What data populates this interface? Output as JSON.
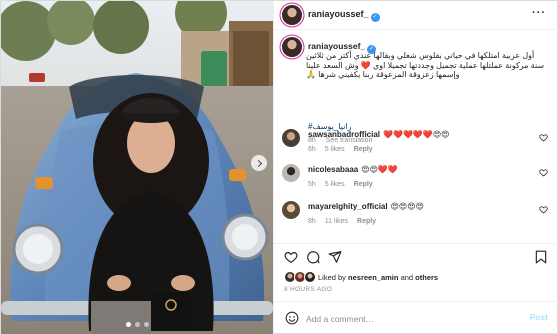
{
  "post": {
    "username": "raniayoussef_",
    "verified_icon": "verified-badge-icon",
    "more_icon": "more-options-icon"
  },
  "caption": {
    "username": "raniayoussef_",
    "text": "أول عربية امتلكها في حياتي بفلوس شغلي وبقالها عندي أكتر من ثلاثين سنة مركونة عملتلها عملية تجميل وجددتها تجميلا اوي ❤️ وش السعد علينا وإسمها زعزوقة المزعوقة ربنا يكفيني شرها 🙏",
    "hashtag": "#رانيا_يوسف",
    "time": "8h",
    "see_translation": "See translation"
  },
  "comments": [
    {
      "username": "sawsanbadrofficial",
      "text": "❤️❤️❤️❤️❤️😍😍",
      "time": "6h",
      "likes": "5 likes",
      "reply": "Reply"
    },
    {
      "username": "nicolesabaaa",
      "text": "😍😍❤️❤️",
      "time": "5h",
      "likes": "5 likes",
      "reply": "Reply"
    },
    {
      "username": "mayarelghity_official",
      "text": "😍😍😍😍",
      "time": "8h",
      "likes": "11 likes",
      "reply": "Reply"
    }
  ],
  "actions": {
    "like_icon": "heart-icon",
    "comment_icon": "comment-icon",
    "share_icon": "share-icon",
    "save_icon": "bookmark-icon"
  },
  "likes": {
    "prefix": "Liked by ",
    "user": "nesreen_amin",
    "middle": " and ",
    "others": "others"
  },
  "time_ago": "8 HOURS AGO",
  "add_comment": {
    "placeholder": "Add a comment…",
    "post_label": "Post",
    "emoji_icon": "emoji-icon"
  },
  "carousel": {
    "slides": 3,
    "active_slide": 1
  },
  "colors": {
    "verified": "#3897f0",
    "link": "#00376b",
    "muted": "#8e8e8e",
    "post_disabled": "#b2dffc",
    "car_body": "#5d86b8"
  }
}
